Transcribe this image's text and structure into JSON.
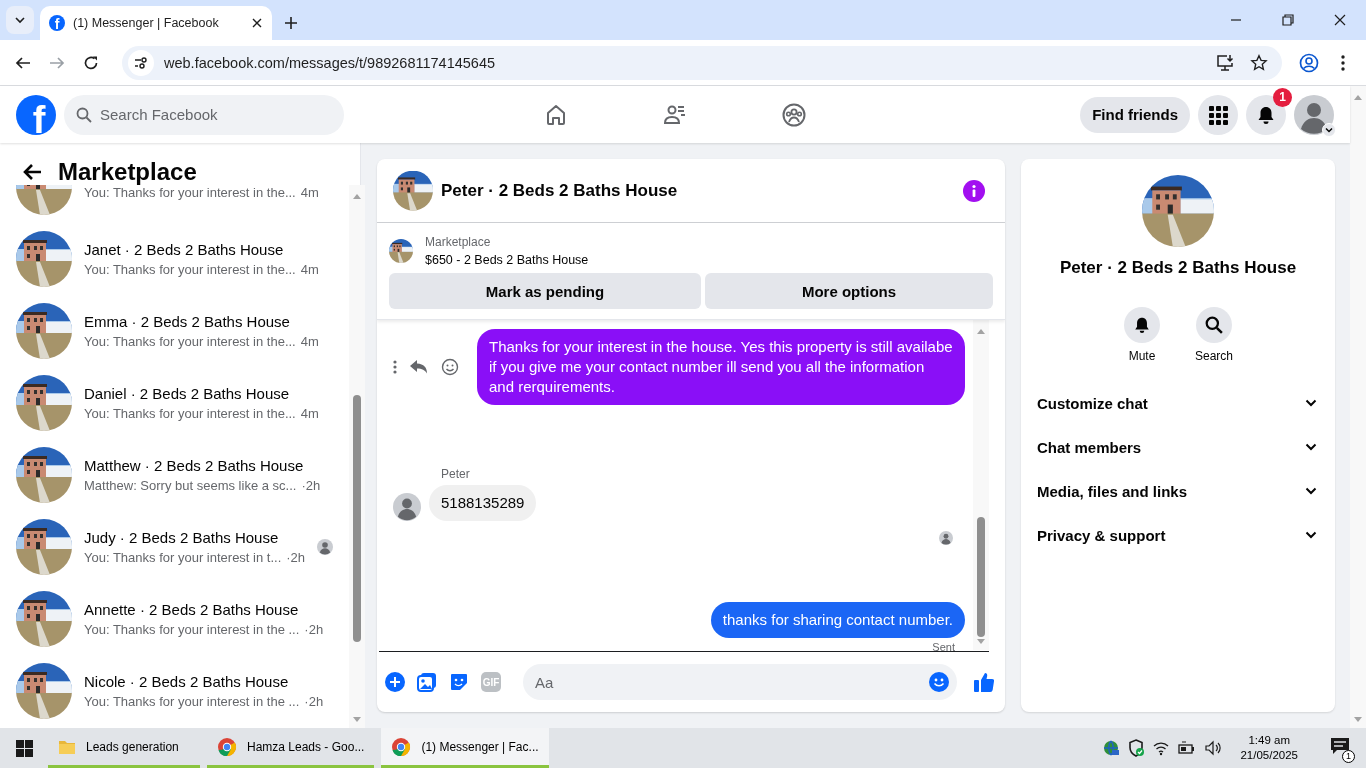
{
  "browser": {
    "tabs": [
      {
        "favicon": "f",
        "title": "(1) Messenger | Facebook",
        "selected": true
      }
    ],
    "url": "web.facebook.com/messages/t/9892681174145645"
  },
  "header": {
    "logo": "f",
    "search_placeholder": "Search Facebook",
    "find_friends": "Find friends",
    "notification_count": "1"
  },
  "sidebar": {
    "title": "Marketplace",
    "conversations": [
      {
        "kind": "partial",
        "preview": "You: Thanks for your interest in the...",
        "time": "4m",
        "seen": false
      },
      {
        "kind": "full",
        "name": "Janet · 2 Beds 2 Baths House",
        "preview": "You: Thanks for your interest in the...",
        "time": "4m",
        "seen": false
      },
      {
        "kind": "full",
        "name": "Emma · 2 Beds 2 Baths House",
        "preview": "You: Thanks for your interest in the...",
        "time": "4m",
        "seen": false
      },
      {
        "kind": "full",
        "name": "Daniel · 2 Beds 2 Baths House",
        "preview": "You: Thanks for your interest in the...",
        "time": "4m",
        "seen": false
      },
      {
        "kind": "full",
        "name": "Matthew · 2 Beds 2 Baths House",
        "preview": "Matthew: Sorry but seems like a sc...",
        "time": "·2h",
        "seen": false
      },
      {
        "kind": "full",
        "name": "Judy · 2 Beds 2 Baths House",
        "preview": "You: Thanks for your interest in t...",
        "time": "·2h",
        "seen": true
      },
      {
        "kind": "full",
        "name": "Annette · 2 Beds 2 Baths House",
        "preview": "You: Thanks for your interest in the ...",
        "time": "·2h",
        "seen": false
      },
      {
        "kind": "full",
        "name": "Nicole · 2 Beds 2 Baths House",
        "preview": "You: Thanks for your interest in the ...",
        "time": "·2h",
        "seen": false
      }
    ]
  },
  "chat": {
    "title": "Peter · 2 Beds 2 Baths House",
    "listing": {
      "source": "Marketplace",
      "title": "$650 - 2 Beds 2 Baths House"
    },
    "buttons": [
      "Mark as pending",
      "More options"
    ],
    "messages": [
      {
        "kind": "outgoing",
        "color": "#8a0ff7",
        "hovered": true,
        "text": "Thanks for your interest in the house. Yes this property is still availabe if you give me your contact number ill send you all the information and rerquirements."
      },
      {
        "kind": "incoming",
        "sender": "Peter",
        "text": "5188135289"
      },
      {
        "kind": "read_receipt"
      },
      {
        "kind": "outgoing",
        "color": "#1b66f5",
        "hovered": false,
        "text": "thanks for sharing contact number.",
        "status": "Sent"
      }
    ],
    "gif_label": "GIF",
    "composer_placeholder": "Aa"
  },
  "details": {
    "name": "Peter · 2 Beds 2 Baths House",
    "actions": [
      {
        "kind": "mute",
        "label": "Mute"
      },
      {
        "kind": "search",
        "label": "Search"
      }
    ],
    "sections": [
      {
        "label": "Customize chat",
        "expanded": false
      },
      {
        "label": "Chat members",
        "expanded": false
      },
      {
        "label": "Media, files and links",
        "expanded": false
      },
      {
        "label": "Privacy & support",
        "expanded": false
      }
    ]
  },
  "taskbar": {
    "items": [
      {
        "kind": "folder",
        "label": "Leads generation",
        "selected": false
      },
      {
        "kind": "browser",
        "label": "Hamza Leads - Goo...",
        "selected": false
      },
      {
        "kind": "browser",
        "label": "(1) Messenger | Fac...",
        "selected": true
      }
    ],
    "time": "1:49 am",
    "date": "21/05/2025",
    "notification_count": "1"
  }
}
